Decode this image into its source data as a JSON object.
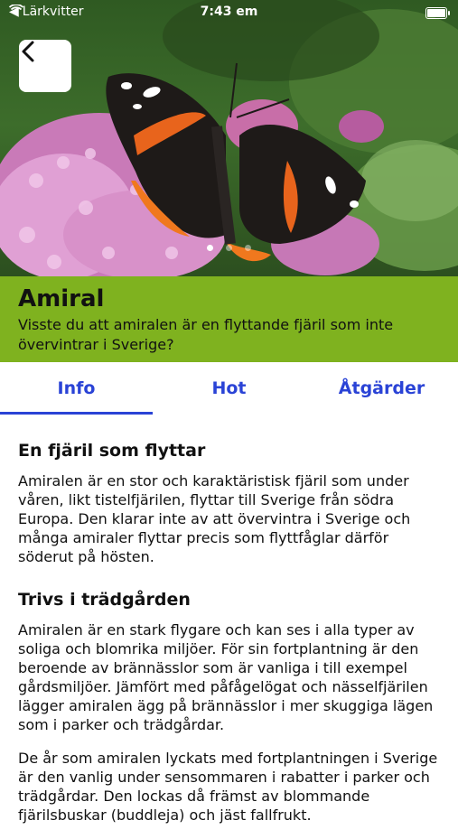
{
  "status_bar": {
    "carrier": "Lärkvitter",
    "time": "7:43 em",
    "battery_level": 0.9
  },
  "hero": {
    "back_icon": "chevron-left-icon",
    "pager_dots": 3,
    "active_dot": 0
  },
  "species": {
    "name": "Amiral",
    "fact": "Visste du att amiralen är en flyttande fjäril som inte övervintrar i Sverige?"
  },
  "tabs": [
    {
      "label": "Info",
      "active": true
    },
    {
      "label": "Hot",
      "active": false
    },
    {
      "label": "Åtgärder",
      "active": false
    }
  ],
  "sections": [
    {
      "heading": "En fjäril som flyttar",
      "paragraphs": [
        "Amiralen är en stor och karaktäristisk fjäril som under våren, likt tistelfjärilen, flyttar till Sverige från södra Europa. Den klarar inte av att övervintra i Sverige och många amiraler flyttar precis som flyttfåglar därför söderut på hösten."
      ]
    },
    {
      "heading": "Trivs i trädgården",
      "paragraphs": [
        "Amiralen är en stark flygare och kan ses i alla typer av soliga och blomrika miljöer. För sin fortplantning är den beroende av brännässlor som är vanliga i till exempel gårdsmiljöer. Jämfört med påfågelögat och nässelfjärilen lägger amiralen ägg på brännässlor i mer skuggiga lägen som i parker och trädgårdar.",
        "De år som amiralen lyckats med fortplantningen i Sverige är den vanlig under sensommaren i rabatter i parker och trädgårdar. Den lockas då främst av blommande fjärilsbuskar (buddleja) och jäst fallfrukt."
      ]
    }
  ],
  "colors": {
    "accent": "#2a43d6",
    "band": "#7fb21f"
  }
}
